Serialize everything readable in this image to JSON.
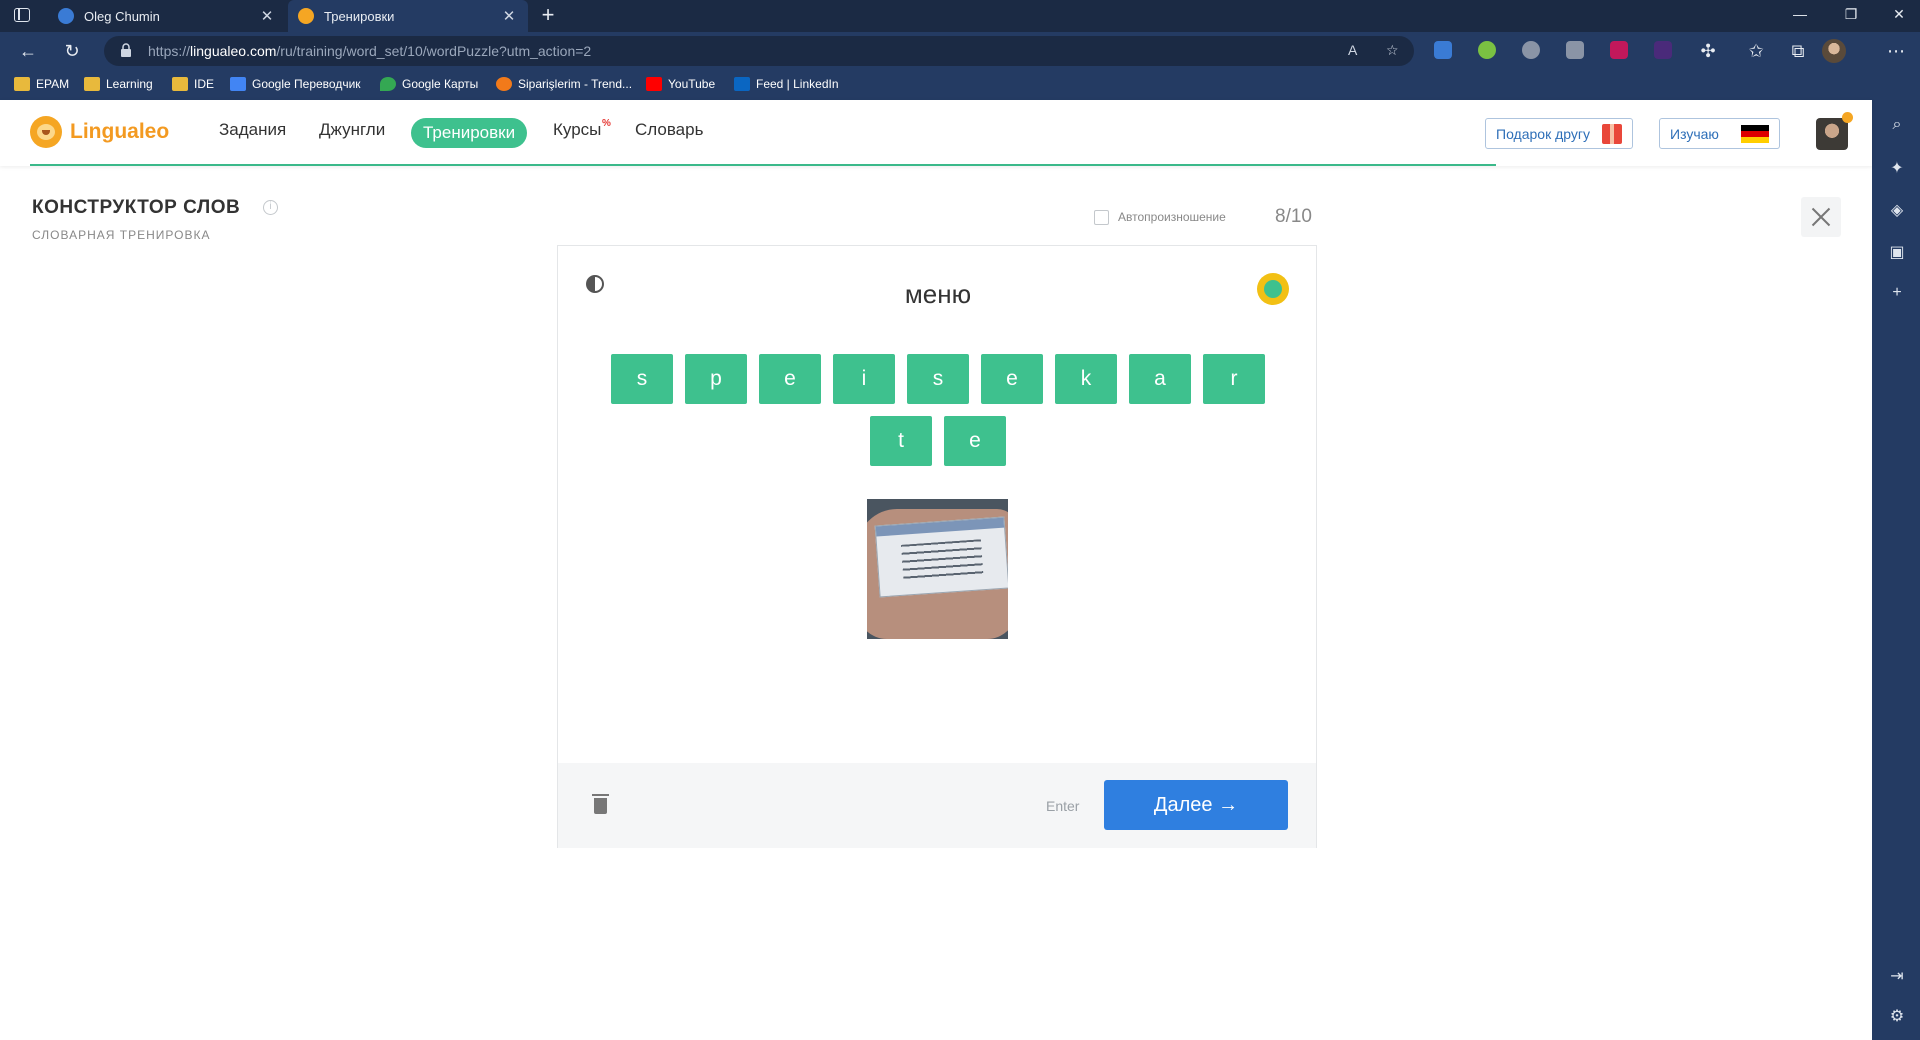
{
  "browser": {
    "tabs": [
      {
        "title": "Oleg Chumin"
      },
      {
        "title": "Тренировки"
      }
    ],
    "url": {
      "prefix": "https://",
      "domain": "lingualeo.com",
      "path": "/ru/training/word_set/10/wordPuzzle?utm_action=2"
    },
    "bookmarks": [
      "EPAM",
      "Learning",
      "IDE",
      "Google Переводчик",
      "Google Карты",
      "Siparişlerim - Trend...",
      "YouTube",
      "Feed | LinkedIn"
    ]
  },
  "site": {
    "logo": "Lingualeo",
    "menu": [
      "Задания",
      "Джунгли",
      "Тренировки",
      "Курсы",
      "Словарь"
    ],
    "courses_badge": "%",
    "gift_button": "Подарок другу",
    "learning_button": "Изучаю"
  },
  "training": {
    "title": "КОНСТРУКТОР СЛОВ",
    "subtitle": "СЛОВАРНАЯ ТРЕНИРОВКА",
    "info_icon": "i",
    "auto_pronounce_label": "Автопроизношение",
    "counter": "8/10",
    "word": "меню",
    "letters": [
      "s",
      "p",
      "e",
      "i",
      "s",
      "e",
      "k",
      "a",
      "r",
      "t",
      "e"
    ],
    "enter_hint": "Enter",
    "next_button": "Далее →"
  },
  "colors": {
    "accent_green": "#3ec18e",
    "next_blue": "#2f7fe0",
    "logo_orange": "#f39a21",
    "chrome_dark": "#1b2a44",
    "chrome_mid": "#243b63"
  },
  "icons": [
    "tab-actions-icon",
    "close-tab-icon",
    "new-tab-icon",
    "back-icon",
    "refresh-icon",
    "lock-icon",
    "read-aloud-icon",
    "favorite-icon",
    "extensions-icon",
    "favorites-bar-icon",
    "collections-icon",
    "search-icon",
    "copilot-icon",
    "theme-toggle-icon",
    "hint-icon",
    "trash-icon",
    "close-icon",
    "gift-icon",
    "flag-de-icon",
    "info-icon"
  ]
}
